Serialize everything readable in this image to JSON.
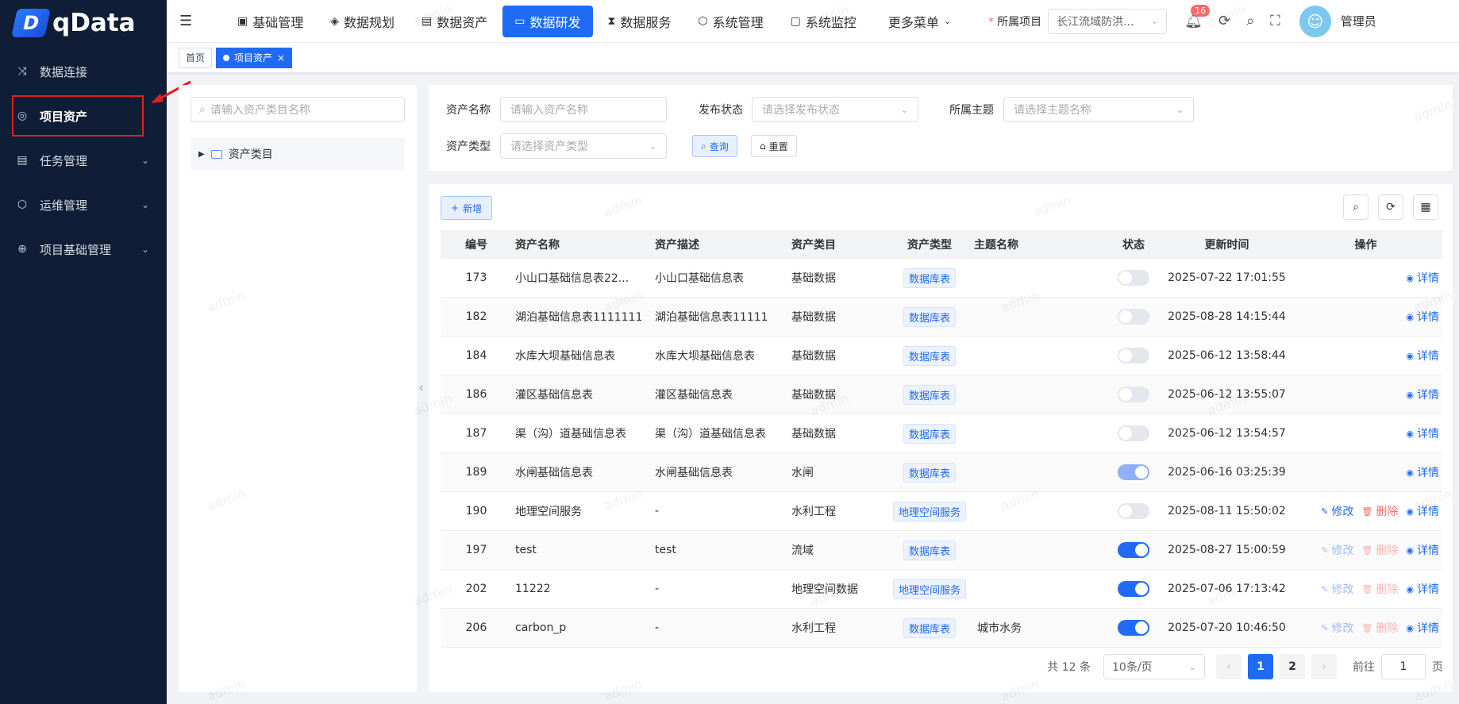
{
  "app": {
    "logo_text": "qData",
    "logo_letter": "D"
  },
  "sidebar": {
    "items": [
      {
        "label": "数据连接",
        "icon": "shuffle-icon",
        "glyph": "⤨",
        "arrow": false
      },
      {
        "label": "项目资产",
        "icon": "asset-icon",
        "glyph": "◎",
        "arrow": false,
        "active": true
      },
      {
        "label": "任务管理",
        "icon": "task-icon",
        "glyph": "▤",
        "arrow": true
      },
      {
        "label": "运维管理",
        "icon": "box-icon",
        "glyph": "⬡",
        "arrow": true
      },
      {
        "label": "项目基础管理",
        "icon": "globe-icon",
        "glyph": "⊕",
        "arrow": true
      }
    ]
  },
  "header": {
    "nav": [
      {
        "label": "基础管理",
        "glyph": "▣"
      },
      {
        "label": "数据规划",
        "glyph": "◈"
      },
      {
        "label": "数据资产",
        "glyph": "▤"
      },
      {
        "label": "数据研发",
        "glyph": "▭",
        "active": true
      },
      {
        "label": "数据服务",
        "glyph": "⧗"
      },
      {
        "label": "系统管理",
        "glyph": "⬡"
      },
      {
        "label": "系统监控",
        "glyph": "▢"
      }
    ],
    "more_label": "更多菜单",
    "project_label": "所属项目",
    "project_value": "长江流域防洪...",
    "notification_count": "16",
    "user_name": "管理员"
  },
  "tabs": [
    {
      "label": "首页",
      "active": false
    },
    {
      "label": "项目资产",
      "active": true
    }
  ],
  "tree": {
    "search_placeholder": "请输入资产类目名称",
    "root_label": "资产类目"
  },
  "filters": {
    "name_label": "资产名称",
    "name_placeholder": "请输入资产名称",
    "status_label": "发布状态",
    "status_placeholder": "请选择发布状态",
    "theme_label": "所属主题",
    "theme_placeholder": "请选择主题名称",
    "type_label": "资产类型",
    "type_placeholder": "请选择资产类型",
    "query_label": "查询",
    "reset_label": "重置"
  },
  "table": {
    "add_label": "新增",
    "columns": [
      "编号",
      "资产名称",
      "资产描述",
      "资产类目",
      "资产类型",
      "主题名称",
      "状态",
      "更新时间",
      "操作"
    ],
    "rows": [
      {
        "id": "173",
        "name": "小山口基础信息表22...",
        "desc": "小山口基础信息表",
        "cat": "基础数据",
        "type": "数据库表",
        "theme": "",
        "status": "off",
        "time": "2025-07-22 17:01:55",
        "ops": [
          "detail"
        ]
      },
      {
        "id": "182",
        "name": "湖泊基础信息表1111111",
        "desc": "湖泊基础信息表11111",
        "cat": "基础数据",
        "type": "数据库表",
        "theme": "",
        "status": "off",
        "time": "2025-08-28 14:15:44",
        "ops": [
          "detail"
        ]
      },
      {
        "id": "184",
        "name": "水库大坝基础信息表",
        "desc": "水库大坝基础信息表",
        "cat": "基础数据",
        "type": "数据库表",
        "theme": "",
        "status": "off",
        "time": "2025-06-12 13:58:44",
        "ops": [
          "detail"
        ]
      },
      {
        "id": "186",
        "name": "灌区基础信息表",
        "desc": "灌区基础信息表",
        "cat": "基础数据",
        "type": "数据库表",
        "theme": "",
        "status": "off",
        "time": "2025-06-12 13:55:07",
        "ops": [
          "detail"
        ]
      },
      {
        "id": "187",
        "name": "渠（沟）道基础信息表",
        "desc": "渠（沟）道基础信息表",
        "cat": "基础数据",
        "type": "数据库表",
        "theme": "",
        "status": "off",
        "time": "2025-06-12 13:54:57",
        "ops": [
          "detail"
        ]
      },
      {
        "id": "189",
        "name": "水闸基础信息表",
        "desc": "水闸基础信息表",
        "cat": "水闸",
        "type": "数据库表",
        "theme": "",
        "status": "on-dim",
        "time": "2025-06-16 03:25:39",
        "ops": [
          "detail"
        ]
      },
      {
        "id": "190",
        "name": "地理空间服务",
        "desc": "-",
        "cat": "水利工程",
        "type": "地理空间服务",
        "theme": "",
        "status": "off",
        "time": "2025-08-11 15:50:02",
        "ops": [
          "edit",
          "del",
          "detail"
        ]
      },
      {
        "id": "197",
        "name": "test",
        "desc": "test",
        "cat": "流域",
        "type": "数据库表",
        "theme": "",
        "status": "on",
        "time": "2025-08-27 15:00:59",
        "ops": [
          "edit-dim",
          "del-dim",
          "detail"
        ]
      },
      {
        "id": "202",
        "name": "11222",
        "desc": "-",
        "cat": "地理空间数据",
        "type": "地理空间服务",
        "theme": "",
        "status": "on",
        "time": "2025-07-06 17:13:42",
        "ops": [
          "edit-dim",
          "del-dim",
          "detail"
        ]
      },
      {
        "id": "206",
        "name": "carbon_p",
        "desc": "-",
        "cat": "水利工程",
        "type": "数据库表",
        "theme": "城市水务",
        "status": "on",
        "time": "2025-07-20 10:46:50",
        "ops": [
          "edit-dim",
          "del-dim",
          "detail"
        ]
      }
    ],
    "op_labels": {
      "edit": "修改",
      "del": "删除",
      "detail": "详情"
    }
  },
  "pagination": {
    "total_text": "共 12 条",
    "page_size": "10条/页",
    "pages": [
      "1",
      "2"
    ],
    "current": "1",
    "goto_label": "前往",
    "goto_value": "1",
    "page_unit": "页"
  },
  "watermark": "admin"
}
